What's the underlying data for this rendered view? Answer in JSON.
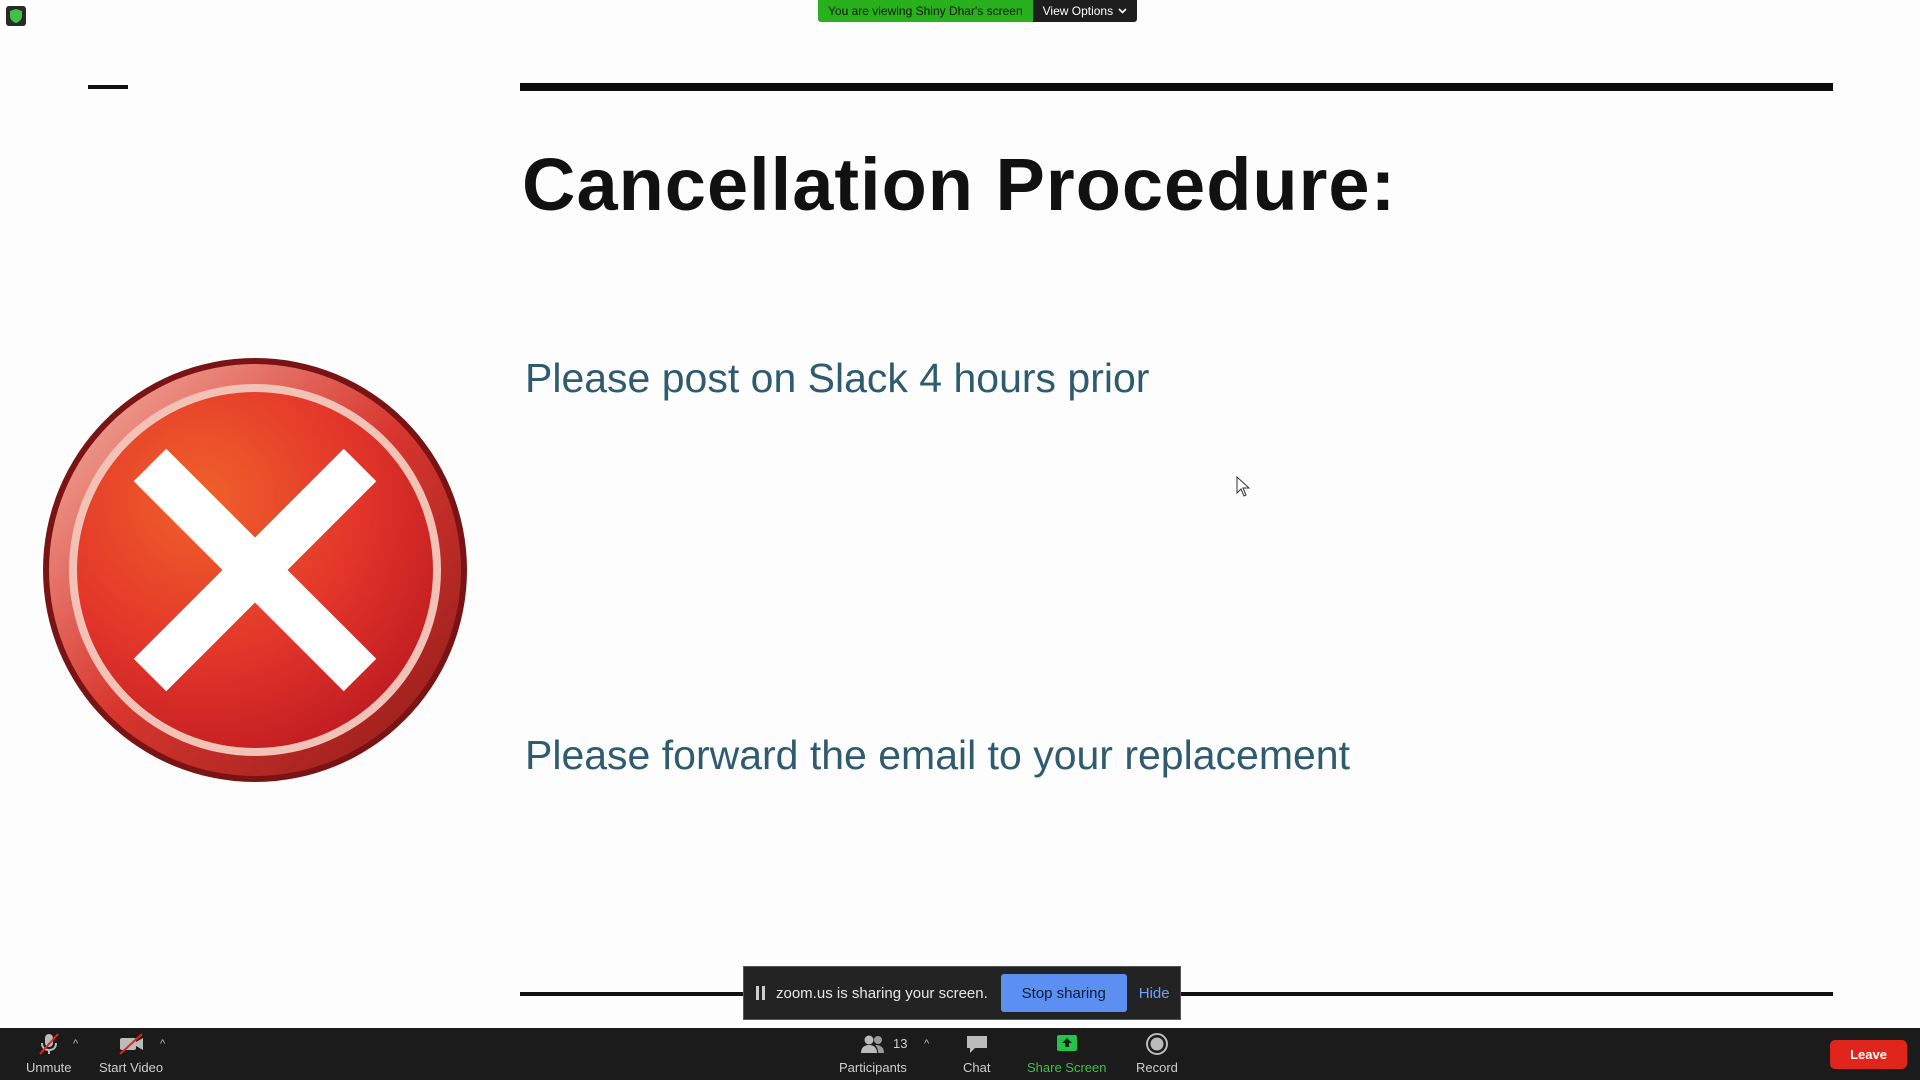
{
  "banner": {
    "viewing_text": "You are viewing Shiny Dhar's screen",
    "view_options_label": "View Options"
  },
  "slide": {
    "title": "Cancellation Procedure:",
    "bullets": [
      "Please post on Slack 4 hours prior",
      "Please forward the email to your replacement"
    ]
  },
  "share_bar": {
    "message": "zoom.us is sharing your screen.",
    "stop_label": "Stop sharing",
    "hide_label": "Hide"
  },
  "toolbar": {
    "unmute_label": "Unmute",
    "start_video_label": "Start Video",
    "participants_label": "Participants",
    "participants_count": "13",
    "chat_label": "Chat",
    "share_screen_label": "Share Screen",
    "record_label": "Record",
    "leave_label": "Leave"
  },
  "colors": {
    "banner_green": "#29b01d",
    "share_screen_green": "#26c24a",
    "leave_red": "#e0251c",
    "stop_sharing_blue": "#5b8ff2",
    "bullet_text": "#2f5b70"
  }
}
